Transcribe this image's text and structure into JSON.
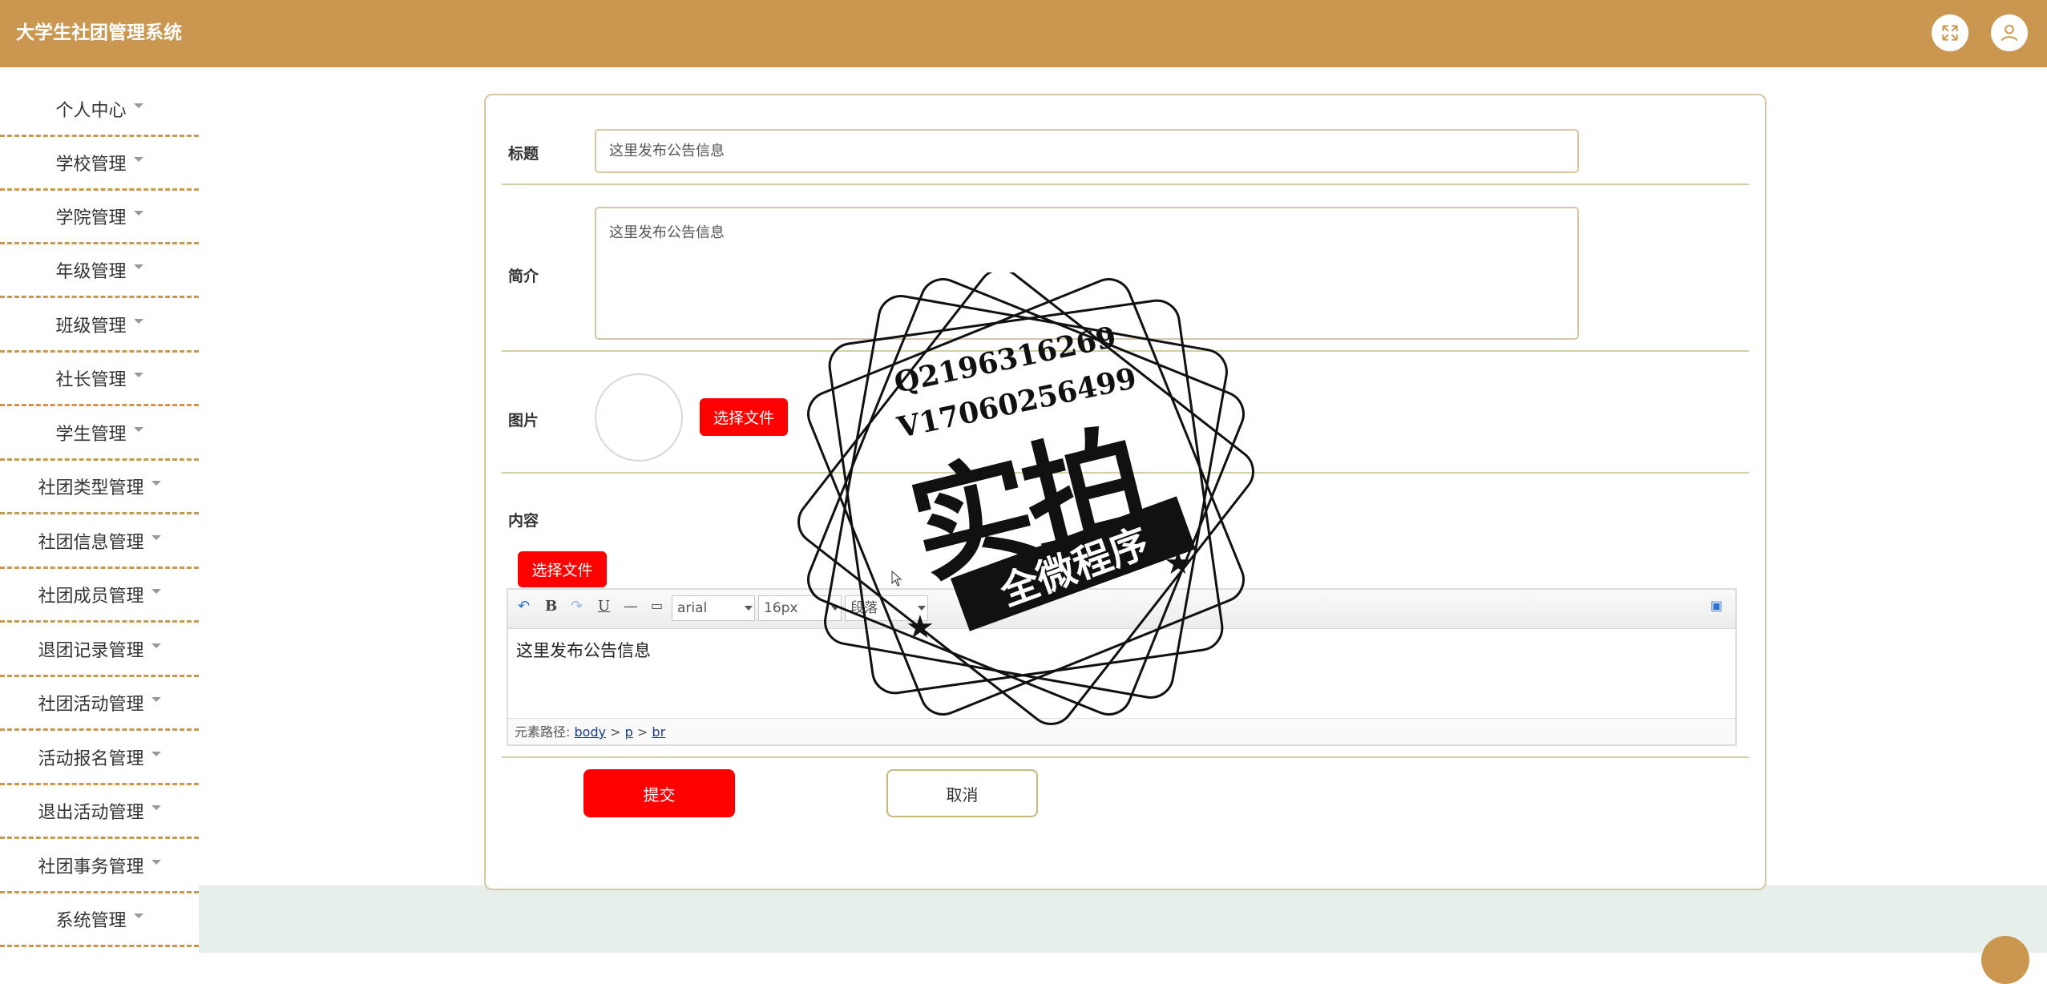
{
  "app": {
    "title": "大学生社团管理系统"
  },
  "topbar": {
    "fullscreen_icon": "fullscreen-icon",
    "user_icon": "user-icon"
  },
  "sidebar": {
    "items": [
      {
        "label": "个人中心"
      },
      {
        "label": "学校管理"
      },
      {
        "label": "学院管理"
      },
      {
        "label": "年级管理"
      },
      {
        "label": "班级管理"
      },
      {
        "label": "社长管理"
      },
      {
        "label": "学生管理"
      },
      {
        "label": "社团类型管理"
      },
      {
        "label": "社团信息管理"
      },
      {
        "label": "社团成员管理"
      },
      {
        "label": "退团记录管理"
      },
      {
        "label": "社团活动管理"
      },
      {
        "label": "活动报名管理"
      },
      {
        "label": "退出活动管理"
      },
      {
        "label": "社团事务管理"
      },
      {
        "label": "系统管理"
      }
    ]
  },
  "form": {
    "title_label": "标题",
    "title_value": "这里发布公告信息",
    "intro_label": "简介",
    "intro_value": "这里发布公告信息",
    "image_label": "图片",
    "image_button": "选择文件",
    "content_label": "内容",
    "content_file_button": "选择文件",
    "editor": {
      "font_family": "arial",
      "font_size": "16px",
      "paragraph": "段落",
      "body_text": "这里发布公告信息",
      "path_label": "元素路径:",
      "path": [
        "body",
        "p",
        "br"
      ],
      "path_separator": ">",
      "tools": {
        "bold": "B",
        "underline": "U",
        "hr": "—"
      }
    },
    "submit_label": "提交",
    "cancel_label": "取消"
  },
  "watermark": {
    "line1": "Q2196316269",
    "line2": "V17060256499",
    "big": "实拍",
    "ribbon": "全微程序"
  }
}
